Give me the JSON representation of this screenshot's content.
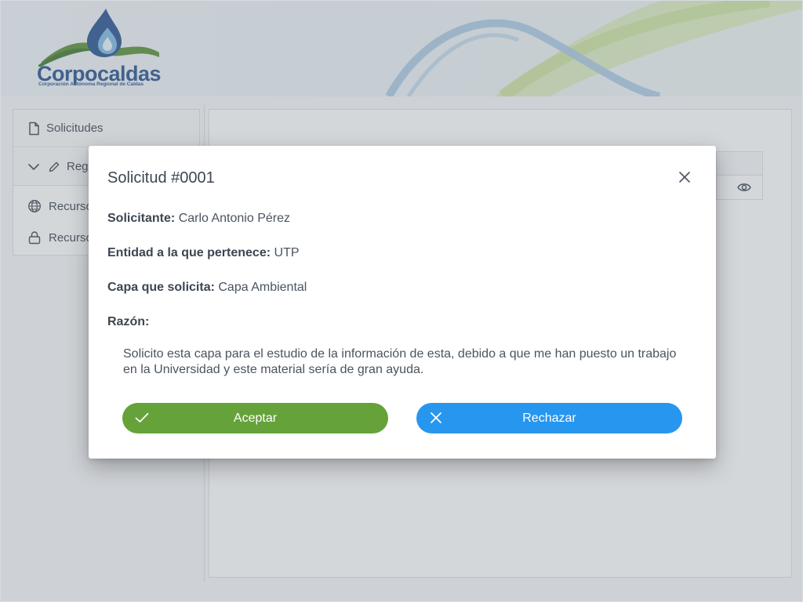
{
  "header": {
    "logo": {
      "name": "Corpocaldas",
      "tagline": "Corporación Autónoma Regional de Caldas"
    },
    "colors": {
      "logo_blue": "#27528f",
      "logo_green": "#5a8f36",
      "wave_green": "#cde39e",
      "wave_blue": "#a8c8e3"
    }
  },
  "sidebar": {
    "items": [
      {
        "label": "Solicitudes",
        "icon": "file-icon"
      },
      {
        "label": "Reg",
        "icon": "pencil-icon",
        "expanded_icon": "chevron-down-icon"
      },
      {
        "label": "Recurso",
        "icon": "globe-icon"
      },
      {
        "label": "Recurso",
        "icon": "lock-icon"
      }
    ]
  },
  "main": {
    "table_action_icon": "eye-icon"
  },
  "modal": {
    "title": "Solicitud #0001",
    "close_icon": "close-icon",
    "fields": {
      "solicitante_label": "Solicitante:",
      "solicitante_value": "Carlo Antonio Pérez",
      "entidad_label": "Entidad a la que pertenece:",
      "entidad_value": "UTP",
      "capa_label": "Capa que solicita:",
      "capa_value": "Capa Ambiental",
      "razon_label": "Razón:"
    },
    "reason_text": "Solicito esta capa para el estudio de la información de esta, debido a que me han puesto un trabajo en la Universidad y este material sería de gran ayuda.",
    "buttons": {
      "accept_label": "Aceptar",
      "accept_icon": "check-icon",
      "reject_label": "Rechazar",
      "reject_icon": "x-icon"
    },
    "colors": {
      "accept": "#66a23a",
      "reject": "#2796ef"
    }
  }
}
